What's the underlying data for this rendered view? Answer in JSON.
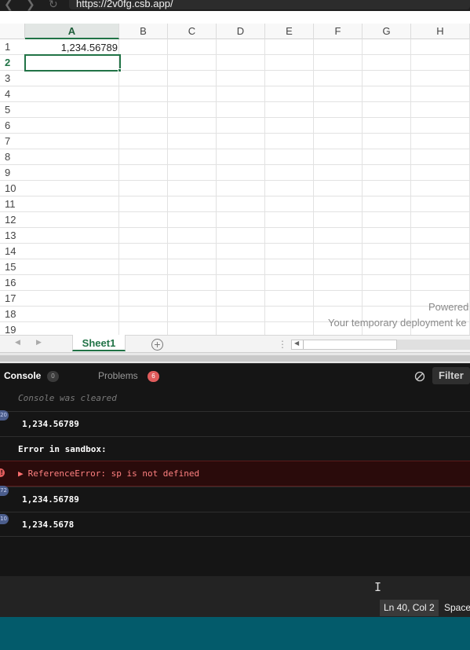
{
  "browser": {
    "url": "https://2v0fg.csb.app/",
    "back_icon": "chevron-left-icon",
    "forward_icon": "chevron-right-icon",
    "reload_icon": "reload-icon"
  },
  "spreadsheet": {
    "columns": [
      "A",
      "B",
      "C",
      "D",
      "E",
      "F",
      "G",
      "H"
    ],
    "rows": [
      "1",
      "2",
      "3",
      "4",
      "5",
      "6",
      "7",
      "8",
      "9",
      "10",
      "11",
      "12",
      "13",
      "14",
      "15",
      "16",
      "17",
      "18",
      "19"
    ],
    "active_column": "A",
    "active_row": "2",
    "cells": {
      "A1": "1,234.56789"
    },
    "watermark_line1": "Powered",
    "watermark_line2": "Your temporary deployment ke",
    "accent_color": "#217346"
  },
  "sheet_tabs": {
    "tabs": [
      "Sheet1"
    ],
    "add_icon": "add-circle-icon"
  },
  "console": {
    "tab_console": "Console",
    "console_badge": "0",
    "tab_problems": "Problems",
    "problems_badge": "6",
    "clear_icon": "clear-console-icon",
    "filter_label": "Filter",
    "cleared_text": "Console was cleared",
    "logs": [
      {
        "count": "20",
        "text": "1,234.56789"
      },
      {
        "text": "Error in sandbox:"
      },
      {
        "count": "!",
        "text": "ReferenceError: sp is not defined",
        "level": "error"
      },
      {
        "count": "72",
        "text": "1,234.56789"
      },
      {
        "count": "10",
        "text": "1,234.5678"
      }
    ]
  },
  "statusbar": {
    "cursor_position": "Ln 40, Col 2",
    "indent": "Spaces"
  },
  "colors": {
    "console_bg": "#151515",
    "error_bg": "#2a0b0b",
    "footer_teal": "#035b6b"
  }
}
